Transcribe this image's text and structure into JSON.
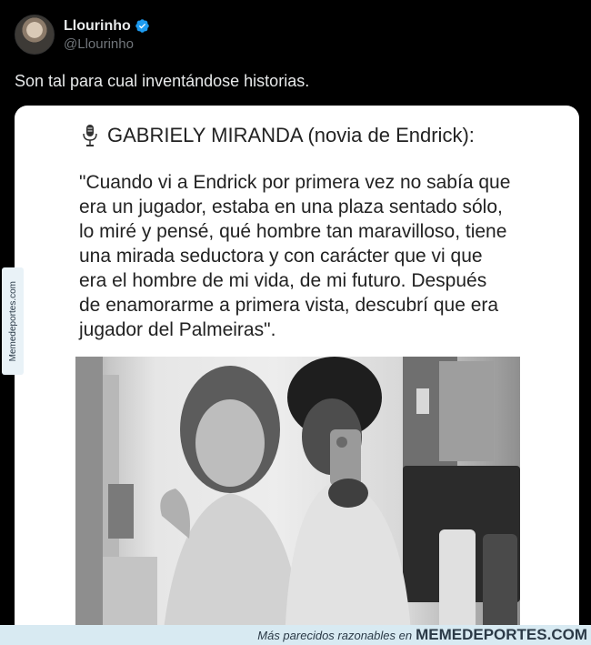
{
  "tweet": {
    "author": {
      "display_name": "Llourinho",
      "handle": "@Llourinho",
      "verified": true
    },
    "text": "Son tal para cual inventándose historias."
  },
  "card": {
    "title": "GABRIELY MIRANDA (novia de Endrick):",
    "quote_lines": [
      "\"Cuando vi a Endrick por primera vez no sabía que",
      "era un jugador, estaba en una plaza sentado sólo,",
      "lo miré y pensé, qué hombre tan maravilloso, tiene",
      "una mirada seductora y con carácter que vi que",
      "era el hombre de mi vida, de mi futuro. Después",
      "de enamorarme a primera vista, descubrí que era",
      "jugador del Palmeiras\"."
    ]
  },
  "watermark": {
    "side": "Memedeportes.com",
    "footer_text": "Más parecidos razonables en",
    "footer_brand": "MEMEDEPORTES.COM"
  },
  "colors": {
    "verified": "#1d9bf0",
    "background": "#000000"
  }
}
